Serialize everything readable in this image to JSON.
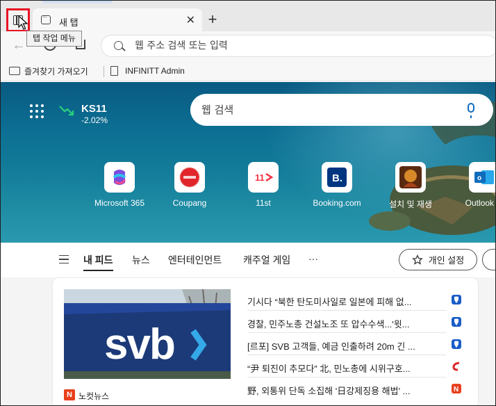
{
  "tabstrip": {
    "tab_title": "새 탭",
    "tooltip": "탭 작업 메뉴"
  },
  "toolbar": {
    "address_placeholder": "웹 주소 검색 또는 입력"
  },
  "favorites": {
    "import_label": "즐겨찾기 가져오기",
    "item_label": "INFINITT Admin"
  },
  "hero": {
    "stock_name": "KS11",
    "stock_change": "-2.02%",
    "search_placeholder": "웹 검색"
  },
  "quicklinks": [
    {
      "label": "Microsoft 365"
    },
    {
      "label": "Coupang"
    },
    {
      "label": "11st"
    },
    {
      "label": "Booking.com"
    },
    {
      "label": "설치 및 재생"
    },
    {
      "label": "Outlook m"
    }
  ],
  "feed_nav": {
    "tabs": [
      "내 피드",
      "뉴스",
      "엔터테인먼트",
      "캐주얼 게임",
      "···"
    ],
    "personalize_label": "개인 설정"
  },
  "feed": {
    "source_name": "노컷뉴스",
    "headlines": [
      {
        "text": "기시다 “북한 탄도미사일로 일본에 피해 없...",
        "source_icon": "shield-blue-icon"
      },
      {
        "text": "경찰, 민주노총 건설노조 또 압수수색...'윗...",
        "source_icon": "shield-blue-icon"
      },
      {
        "text": "[르포] SVB 고객들, 예금 인출하려 20m 긴 ...",
        "source_icon": "shield-blue-icon"
      },
      {
        "text": "“尹 퇴진이 추모다” 北, 민노총에 시위구호...",
        "source_icon": "red-swoosh-icon"
      },
      {
        "text": "野, 외통위 단독 소집해 '日강제징용 해법' ...",
        "source_icon": "red-n-icon"
      }
    ]
  },
  "colors": {
    "highlight_border": "#e81123",
    "hero_sea": "#0c6f93",
    "accent_blue": "#0f6cbd"
  }
}
